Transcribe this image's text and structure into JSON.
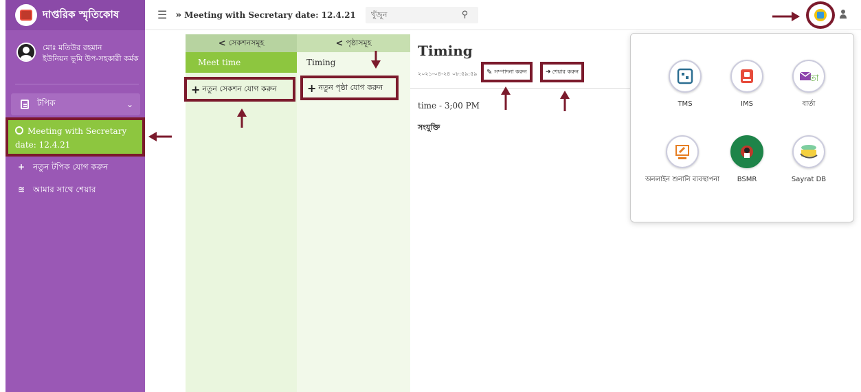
{
  "brand": {
    "title": "দাপ্তরিক স্মৃতিকোষ"
  },
  "user": {
    "name": "মোঃ মতিউর রহমান",
    "designation": "ইউনিয়ন ভূমি উপ-সহকারী কর্মক"
  },
  "sidebar": {
    "topic_header": "টপিক",
    "active_topic_line1": "Meeting with Secretary",
    "active_topic_line2": "date: 12.4.21",
    "add_topic": "নতুন টপিক যোগ করুন",
    "shared_with_me": "আমার সাথে শেয়ার"
  },
  "topbar": {
    "breadcrumb": "Meeting with Secretary date: 12.4.21",
    "search_placeholder": "খুঁজুন"
  },
  "sections": {
    "header": "সেকশনসমূহ",
    "items": [
      "Meet time"
    ],
    "add_label": "নতুন সেকশন যোগ করুন"
  },
  "pages": {
    "header": "পৃষ্ঠাসমূহ",
    "items": [
      "Timing"
    ],
    "add_label": "নতুন পৃষ্ঠা যোগ করুন"
  },
  "content": {
    "title": "Timing",
    "timestamp": "২০২১-০৪-২৪ ০৮:৫৯:৫৯",
    "edit_label": "সম্পাদনা করুন",
    "share_label": "শেয়ার করুন",
    "body": "time - 3;00 PM",
    "attachment_label": "সংযুক্তি"
  },
  "apps": [
    {
      "name": "TMS"
    },
    {
      "name": "IMS"
    },
    {
      "name": "বার্তা"
    },
    {
      "name": "অনলাইন শুনানি ব্যবস্থাপনা"
    },
    {
      "name": "BSMR"
    },
    {
      "name": "Sayrat DB"
    }
  ],
  "colors": {
    "sidebar": "#9a58b5",
    "active_green": "#8dc63f",
    "highlight_border": "#7b1a2c"
  }
}
